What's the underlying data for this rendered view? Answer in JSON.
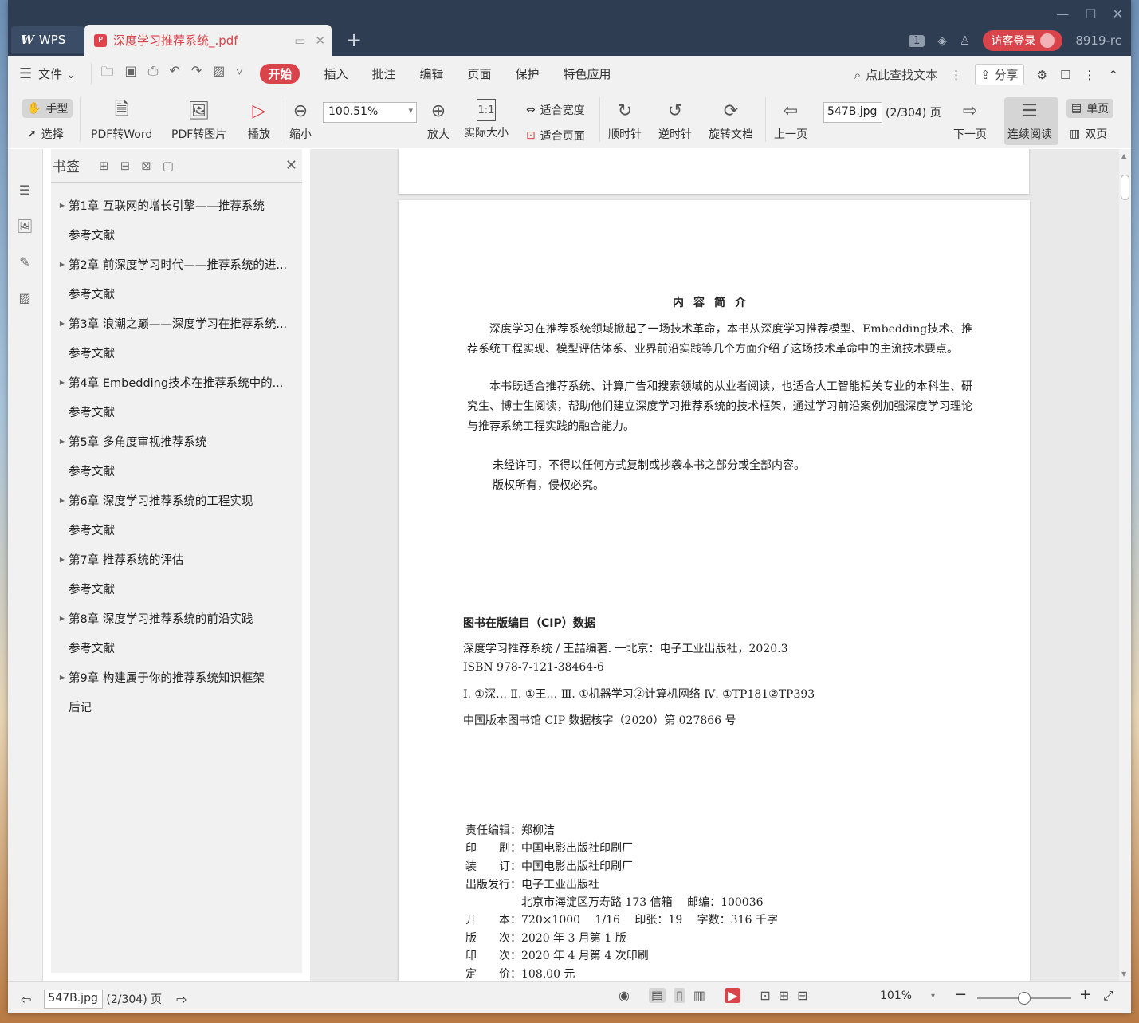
{
  "titlebar": {
    "app_tab": "WPS",
    "doc_tab": "深度学习推荐系统_.pdf",
    "badge": "1",
    "login": "访客登录",
    "user": "8919-rc"
  },
  "menubar": {
    "file": "文件",
    "tabs": [
      "开始",
      "插入",
      "批注",
      "编辑",
      "页面",
      "保护",
      "特色应用"
    ],
    "search": "点此查找文本",
    "share": "分享"
  },
  "toolbar": {
    "hand": "手型",
    "select": "选择",
    "pdf_word": "PDF转Word",
    "pdf_img": "PDF转图片",
    "play": "播放",
    "zoom_out": "缩小",
    "zoom_value": "100.51%",
    "zoom_in": "放大",
    "actual_size": "实际大小",
    "fit_width": "适合宽度",
    "fit_page": "适合页面",
    "clockwise": "顺时针",
    "counter": "逆时针",
    "rotate": "旋转文档",
    "prev": "上一页",
    "page_input": "547B.jpg",
    "page_count": "(2/304) 页",
    "next": "下一页",
    "continuous": "连续阅读",
    "single": "单页",
    "double": "双页"
  },
  "bookmarks": {
    "title": "书签",
    "items": [
      {
        "label": "第1章 互联网的增长引擎——推荐系统",
        "arrow": true
      },
      {
        "label": "参考文献",
        "arrow": false
      },
      {
        "label": "第2章 前深度学习时代——推荐系统的进...",
        "arrow": true
      },
      {
        "label": "参考文献",
        "arrow": false
      },
      {
        "label": "第3章 浪潮之巅——深度学习在推荐系统...",
        "arrow": true
      },
      {
        "label": "参考文献",
        "arrow": false
      },
      {
        "label": "第4章 Embedding技术在推荐系统中的...",
        "arrow": true
      },
      {
        "label": "参考文献",
        "arrow": false
      },
      {
        "label": "第5章 多角度审视推荐系统",
        "arrow": true
      },
      {
        "label": "参考文献",
        "arrow": false
      },
      {
        "label": "第6章 深度学习推荐系统的工程实现",
        "arrow": true
      },
      {
        "label": "参考文献",
        "arrow": false
      },
      {
        "label": "第7章 推荐系统的评估",
        "arrow": true
      },
      {
        "label": "参考文献",
        "arrow": false
      },
      {
        "label": "第8章 深度学习推荐系统的前沿实践",
        "arrow": true
      },
      {
        "label": "参考文献",
        "arrow": false
      },
      {
        "label": "第9章 构建属于你的推荐系统知识框架",
        "arrow": true
      },
      {
        "label": "后记",
        "arrow": false
      }
    ]
  },
  "page": {
    "title": "内容简介",
    "para1": "深度学习在推荐系统领域掀起了一场技术革命，本书从深度学习推荐模型、Embedding技术、推荐系统工程实现、模型评估体系、业界前沿实践等几个方面介绍了这场技术革命中的主流技术要点。",
    "para2": "本书既适合推荐系统、计算广告和搜索领域的从业者阅读，也适合人工智能相关专业的本科生、研究生、博士生阅读，帮助他们建立深度学习推荐系统的技术框架，通过学习前沿案例加强深度学习理论与推荐系统工程实践的融合能力。",
    "copy1": "未经许可，不得以任何方式复制或抄袭本书之部分或全部内容。",
    "copy2": "版权所有，侵权必究。",
    "cip_head": "图书在版编目（CIP）数据",
    "cip1": "深度学习推荐系统 / 王喆编著. 一北京：电子工业出版社，2020.3",
    "cip2": "ISBN 978-7-121-38464-6",
    "cip3": "Ⅰ. ①深… Ⅱ. ①王… Ⅲ. ①机器学习②计算机网络 Ⅳ. ①TP181②TP393",
    "cip4": "中国版本图书馆 CIP 数据核字（2020）第 027866 号",
    "imprint": [
      "责任编辑：郑柳洁",
      "印　　刷：中国电影出版社印刷厂",
      "装　　订：中国电影出版社印刷厂",
      "出版发行：电子工业出版社",
      "　　　　　北京市海淀区万寿路 173 信箱　 邮编：100036",
      "开　　本：720×1000　 1/16　 印张：19　 字数：316 千字",
      "版　　次：2020 年 3 月第 1 版",
      "印　　次：2020 年 4 月第 4 次印刷",
      "定　　价：108.00 元"
    ]
  },
  "status": {
    "page_input": "547B.jpg",
    "page_count": "(2/304) 页",
    "zoom": "101%",
    "zoom_fraction": 0.5
  }
}
